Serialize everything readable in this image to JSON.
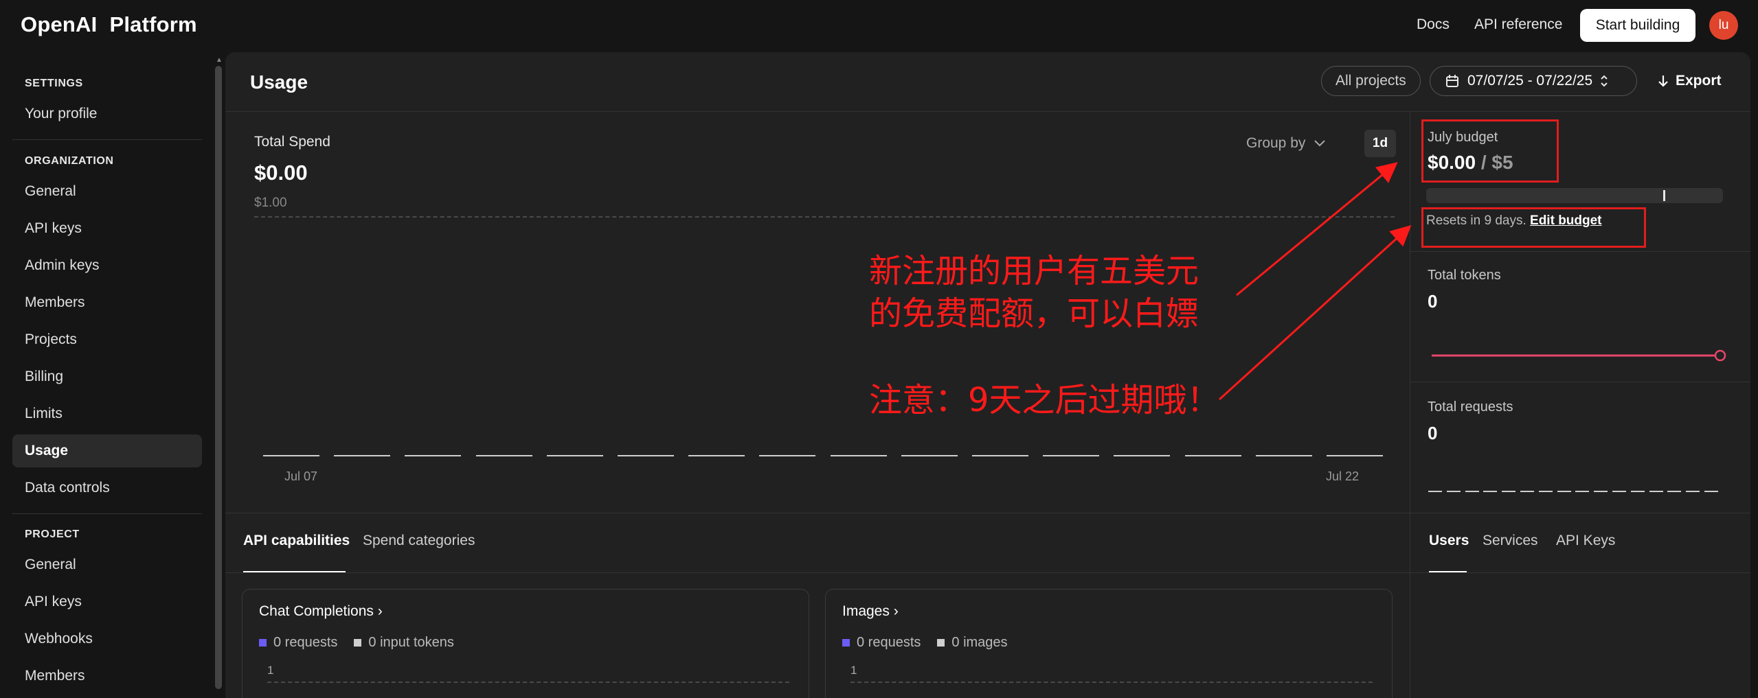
{
  "topbar": {
    "logo_left": "OpenAI",
    "logo_right": "Platform",
    "docs": "Docs",
    "api_reference": "API reference",
    "start_building": "Start building",
    "avatar_initials": "lu"
  },
  "sidebar": {
    "settings_heading": "SETTINGS",
    "settings_items": [
      {
        "label": "Your profile"
      }
    ],
    "organization_heading": "ORGANIZATION",
    "organization_items": [
      {
        "label": "General"
      },
      {
        "label": "API keys"
      },
      {
        "label": "Admin keys"
      },
      {
        "label": "Members"
      },
      {
        "label": "Projects"
      },
      {
        "label": "Billing"
      },
      {
        "label": "Limits"
      },
      {
        "label": "Usage"
      },
      {
        "label": "Data controls"
      }
    ],
    "project_heading": "PROJECT",
    "project_items": [
      {
        "label": "General"
      },
      {
        "label": "API keys"
      },
      {
        "label": "Webhooks"
      },
      {
        "label": "Members"
      }
    ],
    "active_item": "Usage"
  },
  "header": {
    "title": "Usage",
    "project_filter": "All projects",
    "date_range": "07/07/25 - 07/22/25",
    "export": "Export"
  },
  "spend": {
    "title": "Total Spend",
    "value": "$0.00",
    "group_by": "Group by",
    "interval": "1d",
    "gridline_label": "$1.00",
    "x_start": "Jul 07",
    "x_end": "Jul 22"
  },
  "budget": {
    "label": "July budget",
    "spent": "$0.00",
    "separator": "/",
    "limit": "$5",
    "resets_text": "Resets in 9 days.",
    "edit_link": "Edit budget"
  },
  "tokens": {
    "label": "Total tokens",
    "value": "0"
  },
  "requests": {
    "label": "Total requests",
    "value": "0"
  },
  "tabs": {
    "left": [
      "API capabilities",
      "Spend categories"
    ],
    "right": [
      "Users",
      "Services",
      "API Keys"
    ]
  },
  "cards": [
    {
      "title": "Chat Completions",
      "legend": [
        "0 requests",
        "0 input tokens"
      ],
      "axis": "1"
    },
    {
      "title": "Images",
      "legend": [
        "0 requests",
        "0 images"
      ],
      "axis": "1"
    }
  ],
  "annotation": {
    "line1": "新注册的用户有五美元",
    "line2": "的免费配额，可以白嫖",
    "line3": "注意：9天之后过期哦！"
  },
  "colors": {
    "accent_purple": "#6b5cf5",
    "annotation_red": "#ff1a1a",
    "sparkline_pink": "#e8456b",
    "avatar": "#e0442c"
  }
}
